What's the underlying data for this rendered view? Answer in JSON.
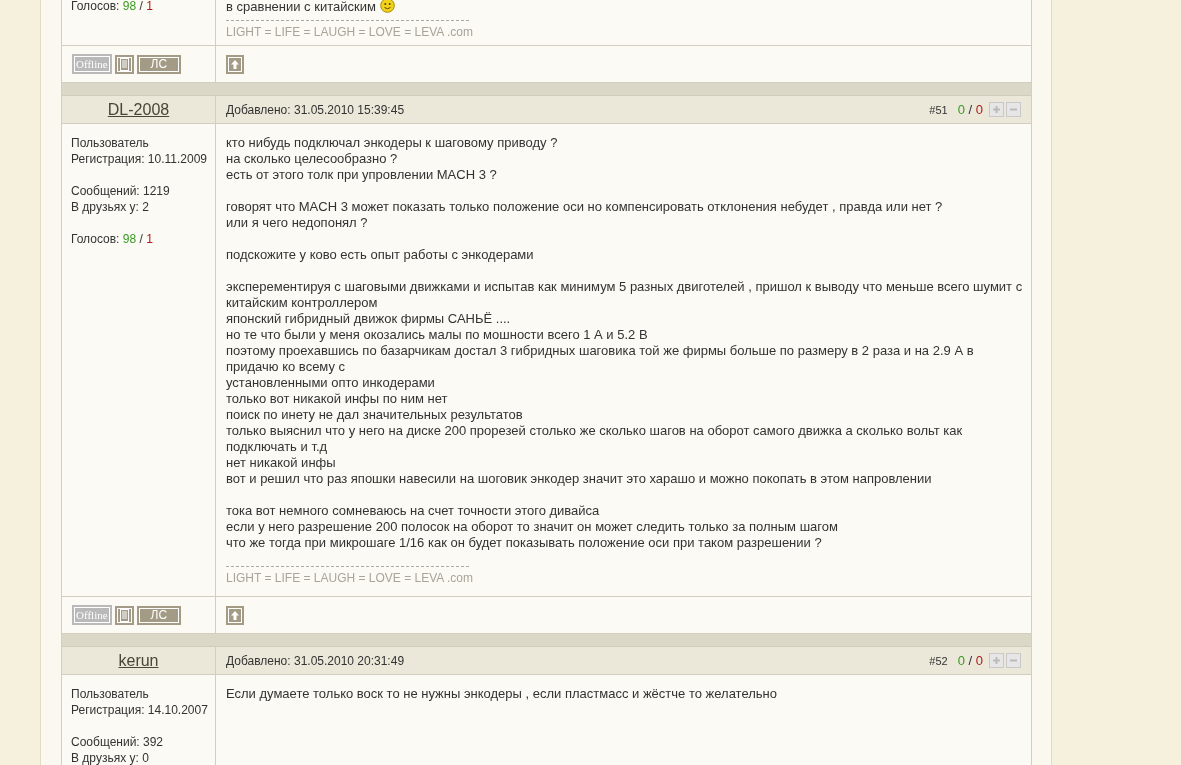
{
  "posts": [
    {
      "votes": {
        "label": "Голосов:",
        "up": "98",
        "sep": "/",
        "down": "1"
      },
      "paragraphs": [
        [
          "в сравнении с китайским"
        ]
      ],
      "ends_with_smiley": true,
      "signature": "LIGHT = LIFE = LAUGH = LOVE = LEVA .com",
      "footer": {
        "status": "Offline",
        "pm": "ЛС"
      }
    },
    {
      "author": "DL-2008",
      "added": "Добавлено: 31.05.2010 15:39:45",
      "number": "#51",
      "rating": {
        "up": "0",
        "sep": "/",
        "down": "0"
      },
      "user_info": [
        [
          "Пользователь",
          "Регистрация: 10.11.2009"
        ],
        [
          "Сообщений: 1219",
          "В друзьях у: 2"
        ]
      ],
      "votes": {
        "label": "Голосов:",
        "up": "98",
        "sep": "/",
        "down": "1"
      },
      "paragraphs": [
        [
          "кто нибудь подключал энкодеры к шаговому приводу ?",
          "на сколько целесообразно ?",
          "есть от этого толк при упровлении MACH 3 ?"
        ],
        [
          "говорят что MACH 3 может показать только положение оси но компенсировать отклонения небудет , правда или нет ?",
          "или я чего недопонял ?"
        ],
        [
          "подскожите у ково есть опыт работы с энкодерами"
        ],
        [
          "эксперементируя с шаговыми движками и испытав как минимум 5 разных двиготелей , пришол к выводу что меньше всего шумит с китайским контроллером",
          "японский гибридный движок фирмы САНЬЁ ....",
          "но те что были у меня окозались малы по мошности всего 1 А и 5.2 В",
          "поэтому проехавшись по базарчикам достал 3 гибридных шаговика той же фирмы больше по размеру в 2 раза и на 2.9 А в придачю ко всему с",
          "установленными опто инкодерами",
          "только вот никакой инфы по ним нет",
          "поиск по инету не дал значительных результатов",
          "только выяснил что у него на диске 200 прорезей столько же сколько шагов на оборот самого движка а сколько вольт как подключать и т.д",
          "нет никакой инфы",
          "вот и решил что раз япошки навесили на шоговик энкодер значит это харашо и можно покопать в этом напровлении"
        ],
        [
          "тока вот немного сомневаюсь на счет точности этого дивайса",
          "если у него разрешение 200 полосок на оборот то значит он может следить только за полным шагом",
          "что же тогда при микрошаге 1/16 как он будет показывать положение оси при таком разрешении ?"
        ]
      ],
      "ends_with_smiley": false,
      "signature": "LIGHT = LIFE = LAUGH = LOVE = LEVA .com",
      "footer": {
        "status": "Offline",
        "pm": "ЛС"
      }
    },
    {
      "author": "kerun",
      "added": "Добавлено: 31.05.2010 20:31:49",
      "number": "#52",
      "rating": {
        "up": "0",
        "sep": "/",
        "down": "0"
      },
      "user_info": [
        [
          "Пользователь",
          "Регистрация: 14.10.2007"
        ],
        [
          "Сообщений: 392",
          "В друзьях у: 0"
        ]
      ],
      "paragraphs": [
        [
          "Если думаете только воск то не нужны энкодеры , если пластмасс и жёстче то желательно"
        ]
      ],
      "ends_with_smiley": false
    }
  ]
}
